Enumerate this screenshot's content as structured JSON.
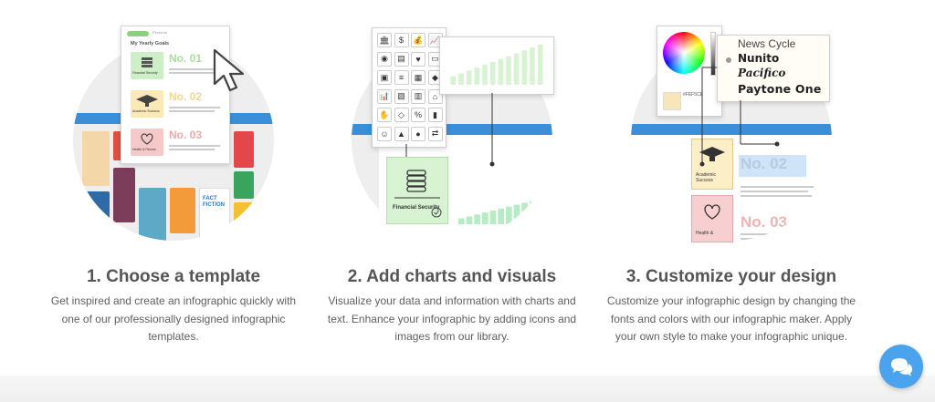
{
  "steps": [
    {
      "title": "1. Choose a template",
      "description": "Get inspired and create an infographic quickly with one of our professionally designed infographic templates.",
      "illustration": {
        "panel_tab": "Personal",
        "panel_heading": "My Yearly Goals",
        "goals": [
          {
            "number": "No. 01",
            "label": "Financial Security",
            "color": "#cdeec6",
            "num_color": "#b7e2ad"
          },
          {
            "number": "No. 02",
            "label": "Academic Success",
            "color": "#fbe9b8",
            "num_color": "#f3dc9a"
          },
          {
            "number": "No. 03",
            "label": "Health & Fitness",
            "color": "#f6c9c9",
            "num_color": "#f0b3b3"
          }
        ],
        "thumb_text": "FACT FICTION"
      }
    },
    {
      "title": "2. Add charts and visuals",
      "description": "Visualize your data and information with charts and text. Enhance your infographic by adding icons and images from our library.",
      "illustration": {
        "card_label": "Financial Security",
        "chart_bars": [
          3,
          4,
          5,
          6,
          7,
          8,
          9,
          10,
          11,
          12,
          13,
          14
        ],
        "icons": [
          "bank-icon",
          "dollar-icon",
          "moneybag-icon",
          "chart-icon",
          "coins-icon",
          "cash-icon",
          "piggy-icon",
          "card-icon",
          "wallet-icon",
          "coin-stack-icon",
          "safe-icon",
          "tag-icon",
          "graph-icon",
          "receipt-icon",
          "calculator-icon",
          "basket-icon",
          "hand-icon",
          "gem-icon",
          "percent-icon",
          "bar-chart-icon",
          "head-icon",
          "bag-icon",
          "coin-icon",
          "exchange-icon"
        ]
      }
    },
    {
      "title": "3. Customize your design",
      "description": "Customize your infographic design by changing the fonts and colors with our infographic maker. Apply your own style to make your infographic unique.",
      "illustration": {
        "fonts": [
          "News Cycle",
          "Nunito",
          "Pacifico",
          "Paytone One"
        ],
        "hex_value": "#FEF5CE",
        "cards": [
          {
            "number": "No. 02",
            "label": "Academic Success"
          },
          {
            "number": "No. 03",
            "label": "Health &"
          }
        ]
      }
    }
  ],
  "colors": {
    "app_blue": "#3a8fd8",
    "chat_blue": "#4aa3ec",
    "mint": "#d7f3d2"
  },
  "chat": {
    "icon": "chat-bubbles-icon"
  }
}
